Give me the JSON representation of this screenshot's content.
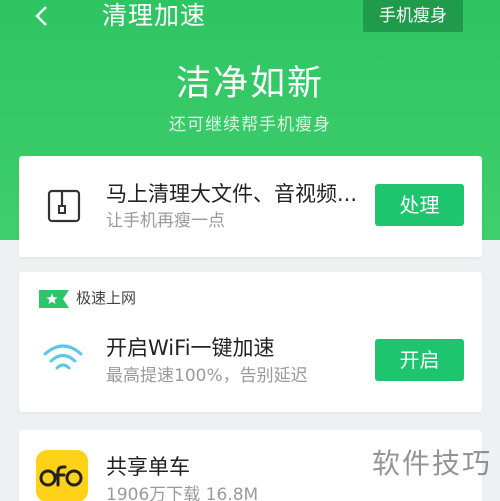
{
  "header": {
    "title": "清理加速",
    "slim_button": "手机瘦身"
  },
  "status": {
    "headline": "洁净如新",
    "subline": "还可继续帮手机瘦身"
  },
  "cards": {
    "cleanup": {
      "title": "马上清理大文件、音视频...",
      "subtitle": "让手机再瘦一点",
      "button": "处理"
    },
    "wifi": {
      "tag": "极速上网",
      "title": "开启WiFi一键加速",
      "subtitle": "最高提速100%，告别延迟",
      "button": "开启"
    },
    "app": {
      "title": "共享单车",
      "subtitle": "1906万下载 16.8M"
    }
  },
  "icons": {
    "back": "chevron-left-icon",
    "file": "file-icon",
    "wifi": "wifi-icon",
    "tag": "flag-star-icon",
    "app_logo": "ofo-logo"
  },
  "colors": {
    "header_green": "#2fc462",
    "button_green": "#1fc46f",
    "slim_button": "#209a4b",
    "wifi_blue": "#5bc8e6",
    "ofo_yellow": "#ffd21a"
  },
  "watermark": "软件技巧"
}
